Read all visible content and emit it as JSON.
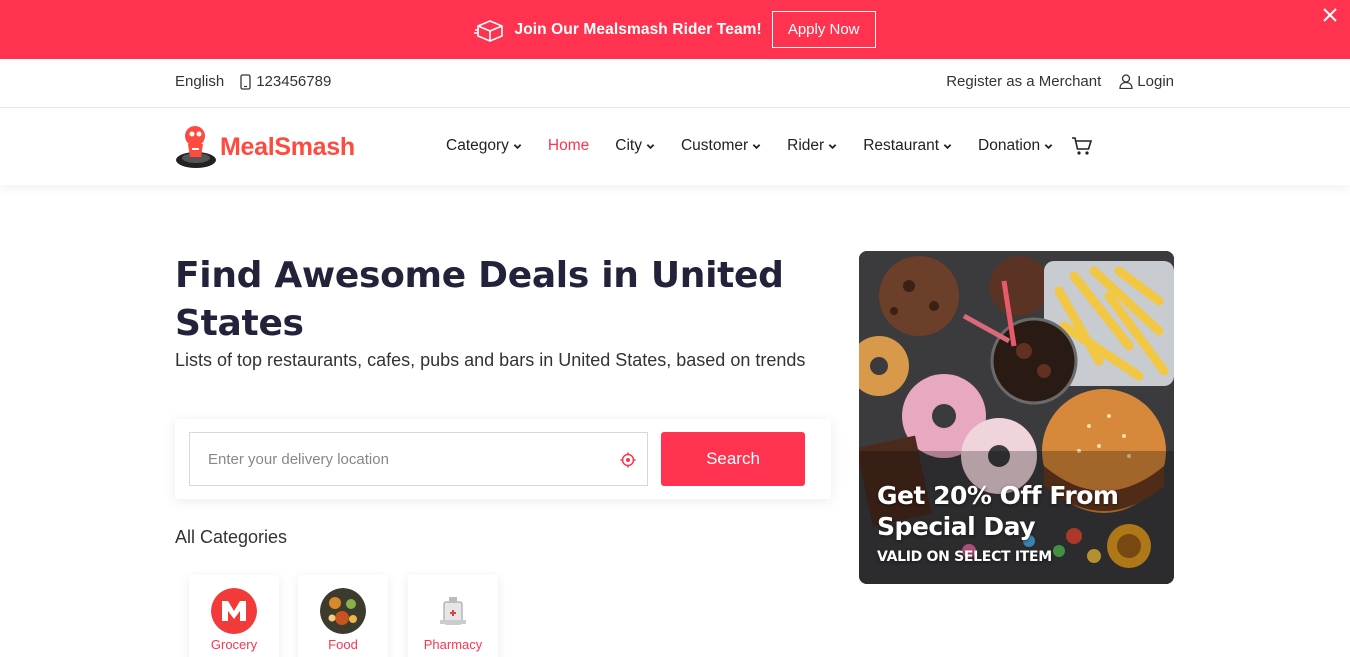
{
  "promo_banner": {
    "icon": "delivery-box-icon",
    "text": "Join Our Mealsmash Rider Team!",
    "button_label": "Apply Now",
    "close_icon": "close-icon"
  },
  "utility_bar": {
    "language": "English",
    "phone_icon": "phone-icon",
    "phone": "123456789",
    "register_label": "Register as a Merchant",
    "login_icon": "user-icon",
    "login_label": "Login"
  },
  "brand": {
    "name": "MealSmash",
    "logo_icon": "mascot-logo-icon",
    "accent_color": "#ff3350"
  },
  "nav": {
    "items": [
      {
        "label": "Category",
        "has_dropdown": true,
        "active": false
      },
      {
        "label": "Home",
        "has_dropdown": false,
        "active": true
      },
      {
        "label": "City",
        "has_dropdown": true,
        "active": false
      },
      {
        "label": "Customer",
        "has_dropdown": true,
        "active": false
      },
      {
        "label": "Rider",
        "has_dropdown": true,
        "active": false
      },
      {
        "label": "Restaurant",
        "has_dropdown": true,
        "active": false
      },
      {
        "label": "Donation",
        "has_dropdown": true,
        "active": false
      }
    ],
    "cart_icon": "cart-icon"
  },
  "hero": {
    "title": "Find Awesome Deals in United States",
    "subtitle": "Lists of top restaurants, cafes, pubs and bars in United States, based on trends",
    "search_placeholder": "Enter your delivery location",
    "search_value": "",
    "location_icon": "location-target-icon",
    "search_button": "Search"
  },
  "categories": {
    "title": "All Categories",
    "items": [
      {
        "label": "Grocery",
        "icon": "grocery-logo-icon"
      },
      {
        "label": "Food",
        "icon": "food-bowl-icon"
      },
      {
        "label": "Pharmacy",
        "icon": "pharmacy-icon"
      }
    ]
  },
  "offer_card": {
    "title": "Get 20% Off From Special Day",
    "subtitle": "VALID ON SELECT ITEM"
  }
}
